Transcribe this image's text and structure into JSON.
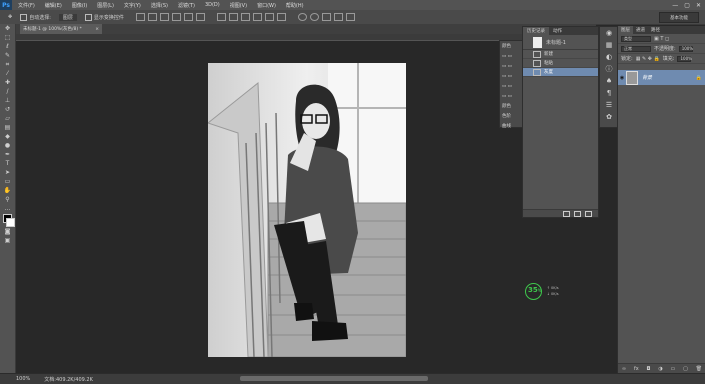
{
  "app": {
    "logo": "Ps"
  },
  "menu": [
    "文件(F)",
    "编辑(E)",
    "图像(I)",
    "图层(L)",
    "文字(Y)",
    "选择(S)",
    "滤镜(T)",
    "3D(D)",
    "视图(V)",
    "窗口(W)",
    "帮助(H)"
  ],
  "window_controls": [
    "—",
    "▢",
    "✕"
  ],
  "options_bar": {
    "auto_select_label": "自动选择:",
    "auto_select_value": "图层",
    "show_transform_label": "显示变换控件"
  },
  "workspace": {
    "label": "基本功能"
  },
  "document_tab": {
    "title": "未标题-1 @ 100%(灰色/8) *"
  },
  "status": {
    "zoom": "100%",
    "doc_info": "文档:409.2K/409.2K"
  },
  "history_panel": {
    "tabs": [
      "历史记录",
      "动作"
    ],
    "snapshot_label": "未标题-1",
    "steps": [
      "新建",
      "粘贴",
      "灰度"
    ],
    "selected_index": 2
  },
  "panel_strip_left": {
    "rows": [
      "颜色",
      "",
      "",
      "",
      "",
      "",
      "颜色",
      "色阶",
      "曲线"
    ]
  },
  "layers_panel": {
    "tabs": [
      "图层",
      "通道",
      "路径"
    ],
    "filter_label": "类型",
    "blend_mode": "正常",
    "opacity_label": "不透明度:",
    "opacity_value": "100%",
    "lock_label": "锁定:",
    "fill_label": "填充:",
    "fill_value": "100%",
    "layer_name": "背景",
    "footer_icons": [
      "link-icon",
      "fx-icon",
      "mask-icon",
      "adjustment-icon",
      "folder-icon",
      "new-layer-icon",
      "trash-icon"
    ]
  },
  "performance": {
    "value": "35",
    "unit": "%",
    "up": "0K/s",
    "down": "0K/s"
  }
}
